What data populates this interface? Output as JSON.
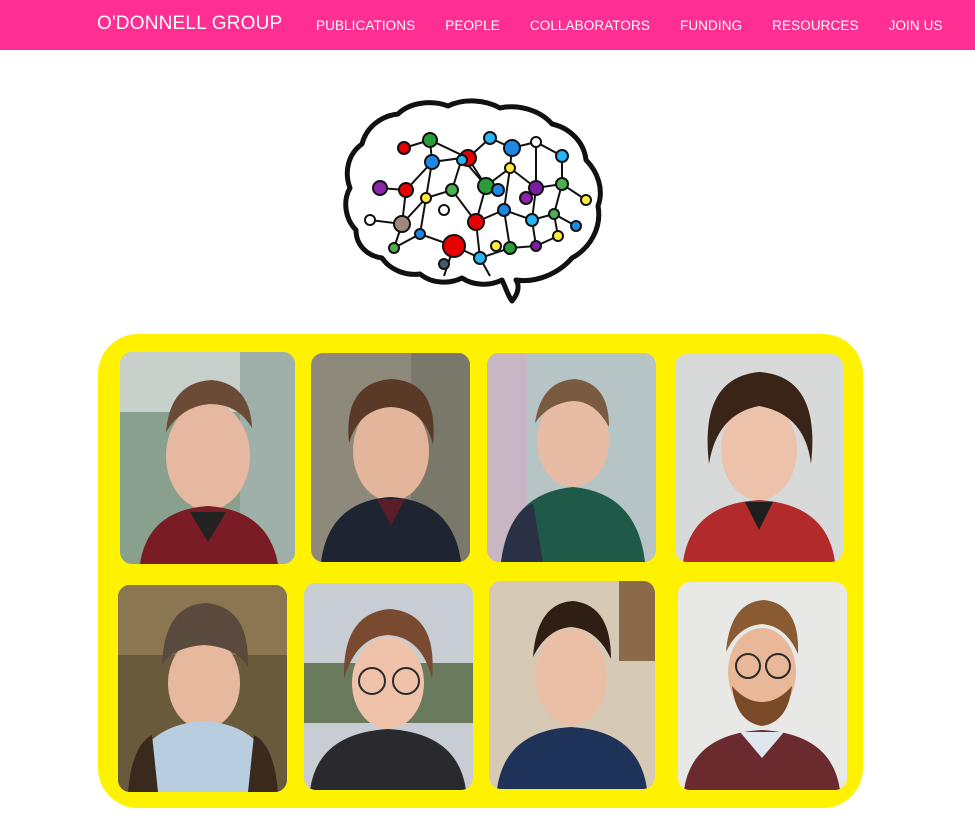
{
  "navbar": {
    "brand": "O'DONNELL GROUP",
    "links": [
      "PUBLICATIONS",
      "PEOPLE",
      "COLLABORATORS",
      "FUNDING",
      "RESOURCES",
      "JOIN US"
    ],
    "background_color": "#ff2e93"
  },
  "logo": {
    "icon": "brain-network-icon"
  },
  "team_photos": {
    "panel_color": "#fff200",
    "count": 8
  }
}
